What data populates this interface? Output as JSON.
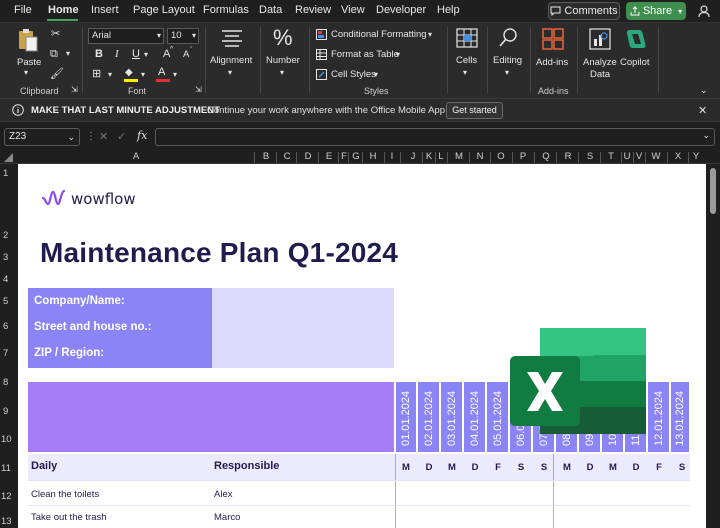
{
  "menu": {
    "items": [
      "File",
      "Home",
      "Insert",
      "Page Layout",
      "Formulas",
      "Data",
      "Review",
      "View",
      "Developer",
      "Help"
    ],
    "active": "Home",
    "comments_label": "Comments",
    "share_label": "Share"
  },
  "ribbon": {
    "paste_label": "Paste",
    "clipboard_label": "Clipboard",
    "font_name": "Arial",
    "font_size": "10",
    "font_group_label": "Font",
    "bold": "B",
    "italic": "I",
    "underline": "U",
    "font_grow": "A",
    "font_shrink": "A",
    "alignment_label": "Alignment",
    "number_label": "Number",
    "conditional_formatting": "Conditional Formatting",
    "format_as_table": "Format as Table",
    "cell_styles": "Cell Styles",
    "styles_label": "Styles",
    "cells_label": "Cells",
    "editing_label": "Editing",
    "addins_label": "Add-ins",
    "addins_group_label": "Add-ins",
    "analyze_data_line1": "Analyze",
    "analyze_data_line2": "Data",
    "copilot_label": "Copilot"
  },
  "infobar": {
    "headline": "MAKE THAT LAST MINUTE ADJUSTMENT",
    "message": "Continue your work anywhere with the Office Mobile App",
    "button": "Get started"
  },
  "formula": {
    "namebox": "Z23",
    "fx": "fx",
    "value": ""
  },
  "columns": [
    "A",
    "B",
    "C",
    "D",
    "E",
    "F",
    "G",
    "H",
    "I",
    "J",
    "K",
    "L",
    "M",
    "N",
    "O",
    "P",
    "Q",
    "R",
    "S",
    "T",
    "U",
    "V",
    "W",
    "X",
    "Y"
  ],
  "rows": [
    "1",
    "2",
    "3",
    "4",
    "5",
    "6",
    "7",
    "8",
    "9",
    "10",
    "11",
    "12",
    "13"
  ],
  "sheet": {
    "logo": "wowflow",
    "title": "Maintenance Plan Q1-2024",
    "company_fields": [
      "Company/Name:",
      "Street and house no.:",
      "ZIP / Region:"
    ],
    "dates": [
      "01.01.2024",
      "02.01.2024",
      "03.01.2024",
      "04.01.2024",
      "05.01.2024",
      "06.01.2024",
      "07.01.2024",
      "08.01.2024",
      "09.01.2024",
      "10.01.2024",
      "11.01.2024",
      "12.01.2024",
      "13.01.2024"
    ],
    "section_label": "Daily",
    "responsible_label": "Responsible",
    "day_letters": [
      "M",
      "D",
      "M",
      "D",
      "F",
      "S",
      "S",
      "M",
      "D",
      "M",
      "D",
      "F",
      "S"
    ],
    "tasks": [
      {
        "task": "Clean the toilets",
        "responsible": "Alex"
      },
      {
        "task": "Take out the trash",
        "responsible": "Marco"
      }
    ]
  },
  "colors": {
    "accent_purple": "#8b84f7",
    "band_purple": "#a77cf7",
    "title_navy": "#1f1d4d",
    "share_green": "#3e8e4e",
    "excel_green": "#107c41"
  }
}
